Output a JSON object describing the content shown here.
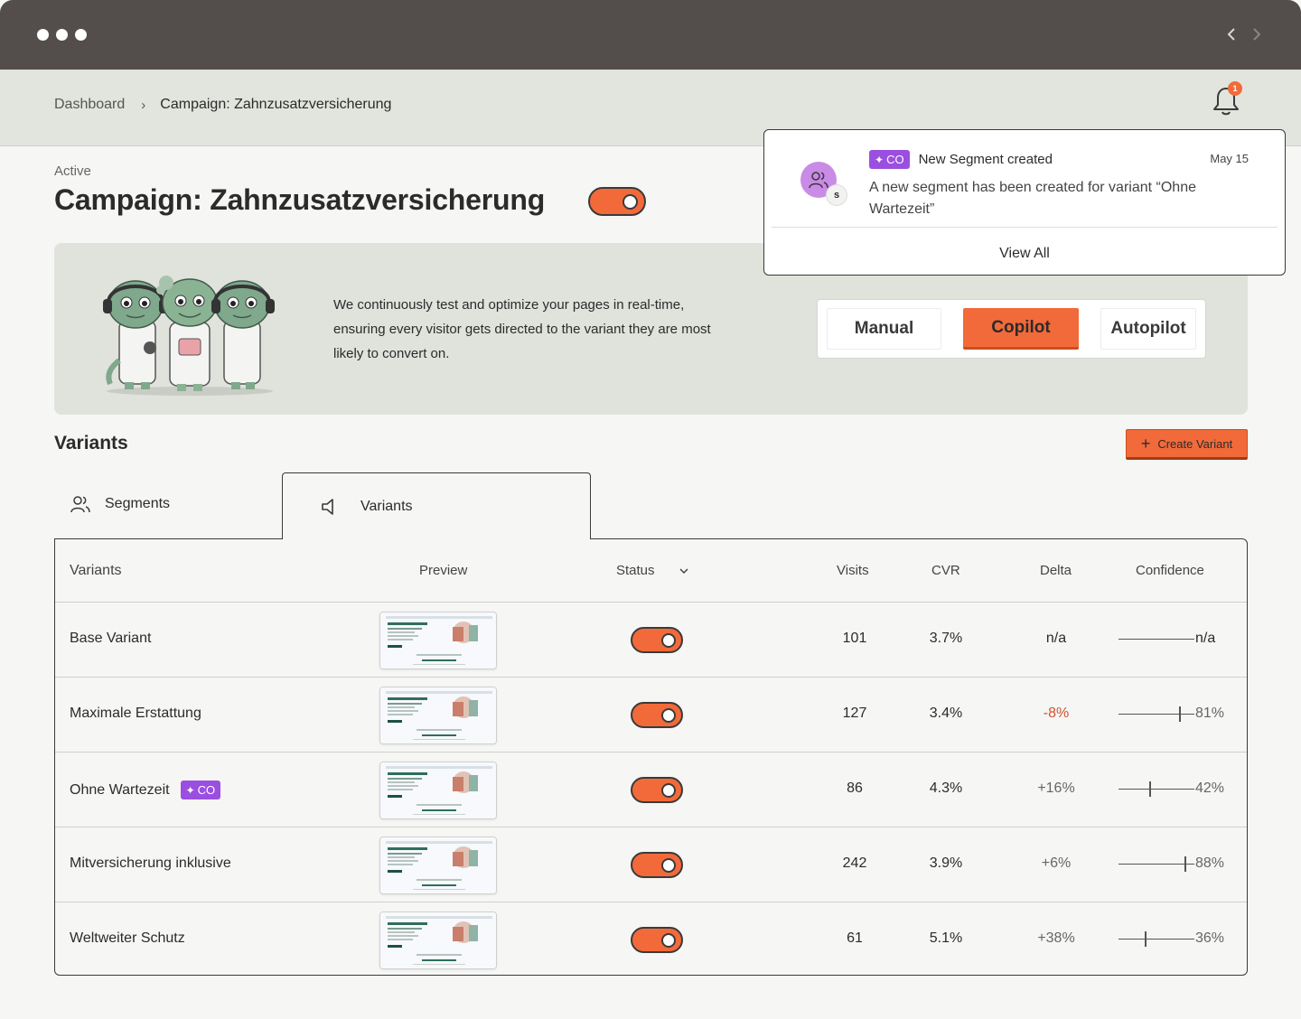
{
  "breadcrumb": {
    "items": [
      "Dashboard",
      "Campaign: Zahnzusatzversicherung"
    ],
    "separator": "›"
  },
  "notifications": {
    "badge_count": "1"
  },
  "campaign": {
    "status": "Active",
    "title": "Campaign: Zahnzusatzversicherung",
    "enabled": true
  },
  "hero": {
    "description": "We continuously test and optimize your pages in real-time, ensuring every visitor gets directed to the variant they are most likely to convert on.",
    "modes": [
      "Manual",
      "Copilot",
      "Autopilot"
    ],
    "selected_mode": "Copilot"
  },
  "variants_section": {
    "title": "Variants",
    "create_label": "Create Variant"
  },
  "tabs": {
    "segments": "Segments",
    "variants": "Variants",
    "active": "Variants"
  },
  "table": {
    "headers": {
      "variants": "Variants",
      "preview": "Preview",
      "status": "Status",
      "visits": "Visits",
      "cvr": "CVR",
      "delta": "Delta",
      "confidence": "Confidence"
    },
    "rows": [
      {
        "name": "Base Variant",
        "badge": "",
        "enabled": true,
        "visits": "101",
        "cvr": "3.7%",
        "delta": "n/a",
        "confidence": "n/a",
        "confidence_pct": null
      },
      {
        "name": "Maximale Erstattung",
        "badge": "",
        "enabled": true,
        "visits": "127",
        "cvr": "3.4%",
        "delta": "-8%",
        "confidence": "81%",
        "confidence_pct": 81
      },
      {
        "name": "Ohne Wartezeit",
        "badge": "CO",
        "enabled": true,
        "visits": "86",
        "cvr": "4.3%",
        "delta": "+16%",
        "confidence": "42%",
        "confidence_pct": 42
      },
      {
        "name": "Mitversicherung inklusive",
        "badge": "",
        "enabled": true,
        "visits": "242",
        "cvr": "3.9%",
        "delta": "+6%",
        "confidence": "88%",
        "confidence_pct": 88
      },
      {
        "name": "Weltweiter Schutz",
        "badge": "",
        "enabled": true,
        "visits": "61",
        "cvr": "5.1%",
        "delta": "+38%",
        "confidence": "36%",
        "confidence_pct": 36
      }
    ]
  },
  "notification_popover": {
    "badge": "CO",
    "title": "New Segment created",
    "date": "May 15",
    "body": "A new segment has been created for variant “Ohne Wartezeit”",
    "avatar_letter": "s",
    "view_all": "View All"
  },
  "colors": {
    "accent": "#f26a3a",
    "copilot_badge": "#9b4fe0",
    "negative": "#d0532e",
    "titlebar": "#534e4b",
    "panel": "#e0e2dc"
  },
  "icons": {
    "window_dots": "three-dots-icon",
    "nav_back": "chevron-left-icon",
    "nav_forward": "chevron-right-icon",
    "bell": "bell-icon",
    "segments_tab": "users-icon",
    "variants_tab": "megaphone-icon",
    "status_sort": "chevron-down-icon",
    "create": "plus-icon",
    "sparkle": "sparkle-icon"
  }
}
